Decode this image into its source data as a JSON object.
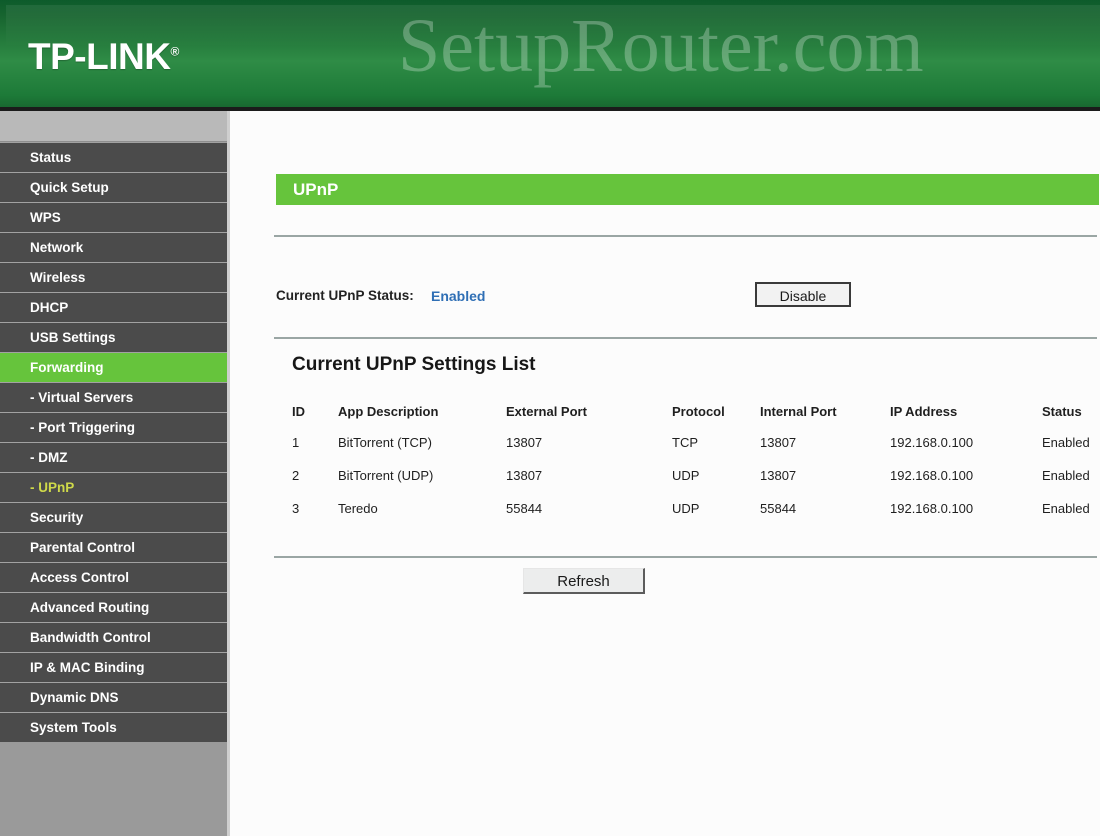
{
  "brand": {
    "logo_text": "TP-LINK",
    "logo_trademark": "®",
    "watermark": "SetupRouter.com"
  },
  "sidebar": {
    "items": [
      {
        "label": "Status",
        "type": "top",
        "state": "normal"
      },
      {
        "label": "Quick Setup",
        "type": "top",
        "state": "normal"
      },
      {
        "label": "WPS",
        "type": "top",
        "state": "normal"
      },
      {
        "label": "Network",
        "type": "top",
        "state": "normal"
      },
      {
        "label": "Wireless",
        "type": "top",
        "state": "normal"
      },
      {
        "label": "DHCP",
        "type": "top",
        "state": "normal"
      },
      {
        "label": "USB Settings",
        "type": "top",
        "state": "normal"
      },
      {
        "label": "Forwarding",
        "type": "top",
        "state": "active"
      },
      {
        "label": "- Virtual Servers",
        "type": "sub",
        "state": "normal"
      },
      {
        "label": "- Port Triggering",
        "type": "sub",
        "state": "normal"
      },
      {
        "label": "- DMZ",
        "type": "sub",
        "state": "normal"
      },
      {
        "label": "- UPnP",
        "type": "sub",
        "state": "current"
      },
      {
        "label": "Security",
        "type": "top",
        "state": "normal"
      },
      {
        "label": "Parental Control",
        "type": "top",
        "state": "normal"
      },
      {
        "label": "Access Control",
        "type": "top",
        "state": "normal"
      },
      {
        "label": "Advanced Routing",
        "type": "top",
        "state": "normal"
      },
      {
        "label": "Bandwidth Control",
        "type": "top",
        "state": "normal"
      },
      {
        "label": "IP & MAC Binding",
        "type": "top",
        "state": "normal"
      },
      {
        "label": "Dynamic DNS",
        "type": "top",
        "state": "normal"
      },
      {
        "label": "System Tools",
        "type": "top",
        "state": "normal"
      }
    ]
  },
  "main": {
    "page_title": "UPnP",
    "status_label": "Current UPnP Status:",
    "status_value": "Enabled",
    "toggle_button_label": "Disable",
    "section_heading": "Current UPnP Settings List",
    "refresh_button_label": "Refresh",
    "table": {
      "headers": [
        "ID",
        "App Description",
        "External Port",
        "Protocol",
        "Internal Port",
        "IP Address",
        "Status"
      ],
      "rows": [
        {
          "id": "1",
          "app_description": "BitTorrent (TCP)",
          "external_port": "13807",
          "protocol": "TCP",
          "internal_port": "13807",
          "ip_address": "192.168.0.100",
          "status": "Enabled"
        },
        {
          "id": "2",
          "app_description": "BitTorrent (UDP)",
          "external_port": "13807",
          "protocol": "UDP",
          "internal_port": "13807",
          "ip_address": "192.168.0.100",
          "status": "Enabled"
        },
        {
          "id": "3",
          "app_description": "Teredo",
          "external_port": "55844",
          "protocol": "UDP",
          "internal_port": "55844",
          "ip_address": "192.168.0.100",
          "status": "Enabled"
        }
      ]
    }
  },
  "colors": {
    "header_green_dark": "#0d5b2b",
    "header_green_light": "#2f8c46",
    "accent_green": "#66c43c",
    "sidebar_item_bg": "#4b4b4b",
    "sidebar_bg": "#9a9a9a",
    "status_blue": "#2f6fb5",
    "current_sub_text": "#cfd94a"
  }
}
